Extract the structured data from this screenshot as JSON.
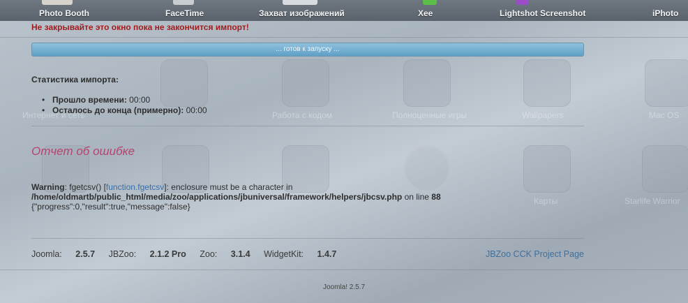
{
  "dock": {
    "items": [
      "Photo Booth",
      "FaceTime",
      "Захват изображений",
      "Xee",
      "Lightshot Screenshot",
      "iPhoto"
    ]
  },
  "import": {
    "warning": "Не закрывайте это окно пока не закончится импорт!",
    "progress_text": "... готов к запуску ...",
    "progress": 0,
    "stats_title": "Статистика импорта:",
    "elapsed_label": "Прошло времени:",
    "elapsed_value": "00:00",
    "remaining_label": "Осталось до конца (примерно):",
    "remaining_value": "00:00"
  },
  "error": {
    "title": "Отчет об ошибке",
    "warning_label": "Warning",
    "fn_prefix": ": fgetcsv() [",
    "fn_link": "function.fgetcsv",
    "message": "]: enclosure must be a character in",
    "path": "/home/oldmartb/public_html/media/zoo/applications/jbuniversal/framework/helpers/jbcsv.php",
    "line_label": "on line",
    "line_number": "88",
    "json_output": "{\"progress\":0,\"result\":true,\"message\":false}"
  },
  "footer": {
    "joomla_label": "Joomla:",
    "joomla_version": "2.5.7",
    "jbzoo_label": "JBZoo:",
    "jbzoo_version": "2.1.2 Pro",
    "zoo_label": "Zoo:",
    "zoo_version": "3.1.4",
    "widgetkit_label": "WidgetKit:",
    "widgetkit_version": "1.4.7",
    "project_link": "JBZoo CCK Project Page",
    "bottom_text": "Joomla! 2.5.7"
  },
  "background_labels": [
    "Интернет и сеть",
    "Работа с кодом",
    "Полноценные игры",
    "Wallpapers",
    "Mac OS",
    "Карты",
    "Starlife Warrior"
  ]
}
